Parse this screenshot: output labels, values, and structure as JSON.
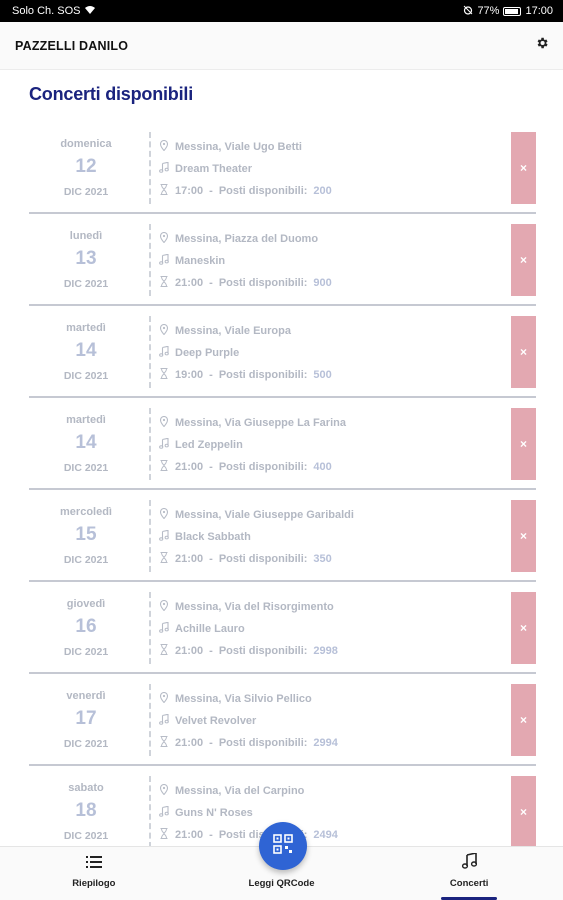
{
  "status_bar": {
    "carrier": "Solo Ch. SOS",
    "battery": "77%",
    "time": "17:00"
  },
  "app_bar": {
    "user_name": "PAZZELLI DANILO",
    "settings_icon": "gear-icon"
  },
  "page": {
    "title": "Concerti disponibili"
  },
  "concerts": [
    {
      "weekday": "domenica",
      "day": "12",
      "month": "DIC 2021",
      "location": "Messina, Viale Ugo Betti",
      "artist": "Dream Theater",
      "time": "17:00",
      "seats_label": "Posti disponibili:",
      "seats": "200"
    },
    {
      "weekday": "lunedì",
      "day": "13",
      "month": "DIC 2021",
      "location": "Messina, Piazza del Duomo",
      "artist": "Maneskin",
      "time": "21:00",
      "seats_label": "Posti disponibili:",
      "seats": "900"
    },
    {
      "weekday": "martedì",
      "day": "14",
      "month": "DIC 2021",
      "location": "Messina, Viale Europa",
      "artist": "Deep Purple",
      "time": "19:00",
      "seats_label": "Posti disponibili:",
      "seats": "500"
    },
    {
      "weekday": "martedì",
      "day": "14",
      "month": "DIC 2021",
      "location": "Messina, Via Giuseppe La Farina",
      "artist": "Led Zeppelin",
      "time": "21:00",
      "seats_label": "Posti disponibili:",
      "seats": "400"
    },
    {
      "weekday": "mercoledì",
      "day": "15",
      "month": "DIC 2021",
      "location": "Messina, Viale Giuseppe Garibaldi",
      "artist": "Black Sabbath",
      "time": "21:00",
      "seats_label": "Posti disponibili:",
      "seats": "350"
    },
    {
      "weekday": "giovedì",
      "day": "16",
      "month": "DIC 2021",
      "location": "Messina, Via del Risorgimento",
      "artist": "Achille Lauro",
      "time": "21:00",
      "seats_label": "Posti disponibili:",
      "seats": "2998"
    },
    {
      "weekday": "venerdì",
      "day": "17",
      "month": "DIC 2021",
      "location": "Messina, Via Silvio Pellico",
      "artist": "Velvet Revolver",
      "time": "21:00",
      "seats_label": "Posti disponibili:",
      "seats": "2994"
    },
    {
      "weekday": "sabato",
      "day": "18",
      "month": "DIC 2021",
      "location": "Messina, Via del Carpino",
      "artist": "Guns N' Roses",
      "time": "21:00",
      "seats_label": "Posti disponibili:",
      "seats": "2494"
    }
  ],
  "card_icons": {
    "location": "map-pin-icon",
    "artist": "music-note-icon",
    "time": "hourglass-icon",
    "delete": "close-icon",
    "delete_glyph": "×"
  },
  "time_seats_separator": "-",
  "bottom_nav": {
    "items": [
      {
        "label": "Riepilogo",
        "icon": "list-icon"
      },
      {
        "label": "Leggi QRCode",
        "icon": "qr-code-icon"
      },
      {
        "label": "Concerti",
        "icon": "music-note-icon",
        "active": true
      }
    ]
  },
  "colors": {
    "title": "#1a237e",
    "fab": "#2f64d4",
    "delete": "#e3a8b1",
    "card_text": "#b3b8c3"
  }
}
